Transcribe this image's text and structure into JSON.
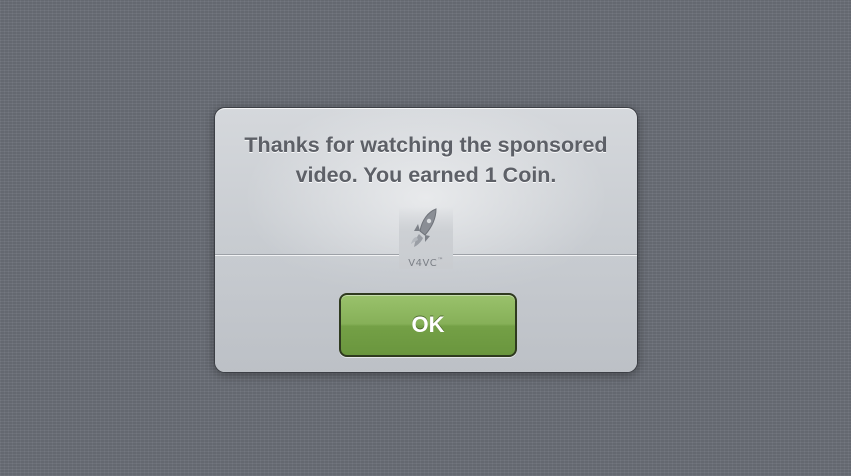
{
  "dialog": {
    "message": "Thanks for watching the sponsored\nvideo.  You earned 1 Coin.",
    "brand": {
      "icon": "rocket-icon",
      "label": "V4VC",
      "trademark": "™"
    },
    "ok_button_label": "OK"
  },
  "colors": {
    "button_green": "#86b058",
    "dialog_surface": "#d5d8dc",
    "background_linen": "#6b6f78",
    "message_text": "#5d6067"
  }
}
